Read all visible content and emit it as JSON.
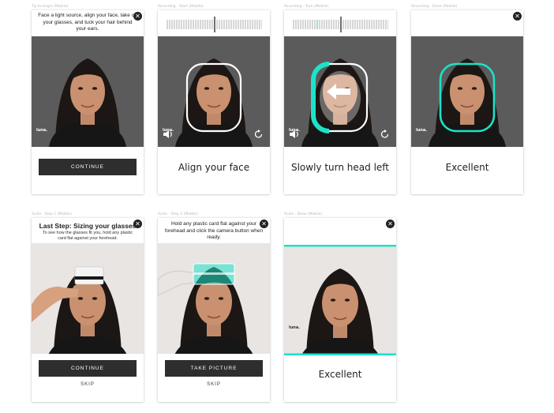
{
  "frames": [
    {
      "label": "Tip to begin (Mobile)",
      "instruction": "Face a light source, align your face, take off your glasses, and tuck your hair behind your ears.",
      "button": "CONTINUE",
      "brand": "luna."
    },
    {
      "label": "Recording - Start (Mobile)",
      "caption": "Align your face",
      "brand": "luna."
    },
    {
      "label": "Recording - Turn (Mobile)",
      "caption": "Slowly turn head left",
      "brand": "luna."
    },
    {
      "label": "Recording - Done (Mobile)",
      "caption": "Excellent",
      "brand": "luna."
    },
    {
      "label": "Scale - Step 1 (Mobile)",
      "title": "Last Step: Sizing your glasses",
      "subtitle": "To see how the glasses fit you, hold any plastic card flat against your forehead.",
      "button": "CONTINUE",
      "skip": "SKIP"
    },
    {
      "label": "Scale - Step 2 (Mobile)",
      "instruction": "Hold any plastic card flat against your forehead and click the camera button when ready.",
      "button": "TAKE PICTURE",
      "skip": "SKIP"
    },
    {
      "label": "Scale - Done (Mobile)",
      "caption": "Excellent",
      "brand": "luna."
    }
  ],
  "icons": {
    "close": "close-icon",
    "sound": "speaker-icon",
    "rotate": "rotate-icon",
    "arrow": "arrow-left-icon",
    "card": "card-icon",
    "hand": "hand-icon"
  },
  "colors": {
    "accent": "#1de2c8",
    "button": "#2e2e2e",
    "photo_bg_dark": "#5a5a5a",
    "photo_bg_light": "#e9e6e4"
  }
}
